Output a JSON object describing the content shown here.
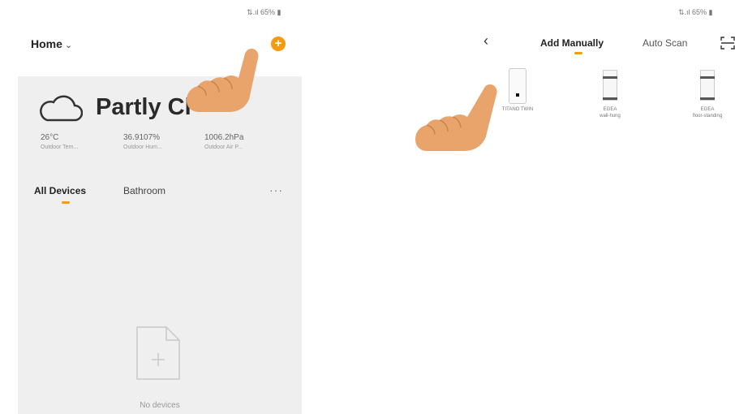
{
  "left_screen": {
    "status_bar": "⇅.ıl 65% ▮",
    "header": {
      "title": "Home",
      "add_symbol": "+"
    },
    "weather": {
      "condition": "Partly Cl",
      "icon": "cloud-icon"
    },
    "metrics": [
      {
        "value": "26°C",
        "label": "Outdoor Tem..."
      },
      {
        "value": "36.9107%",
        "label": "Outdoor Hum..."
      },
      {
        "value": "1006.2hPa",
        "label": "Outdoor Air P..."
      }
    ],
    "tabs": [
      {
        "label": "All Devices",
        "active": true
      },
      {
        "label": "Bathroom",
        "active": false
      }
    ],
    "more_label": "···",
    "empty_state": {
      "text": "No devices",
      "icon": "add-document-icon"
    }
  },
  "right_screen": {
    "status_bar": "⇅.ıl 65% ▮",
    "back_symbol": "‹",
    "tabs": [
      {
        "label": "Add Manually",
        "active": true
      },
      {
        "label": "Auto Scan",
        "active": false
      }
    ],
    "devices": [
      {
        "label": "TITANO TWIN",
        "sublabel": ""
      },
      {
        "label": "EGEA",
        "sublabel": "wall-hung"
      },
      {
        "label": "EGEA",
        "sublabel": "floor-standing"
      }
    ]
  },
  "colors": {
    "accent": "#f39c12",
    "background_grey": "#efefef",
    "hand_skin": "#e8a46b"
  }
}
